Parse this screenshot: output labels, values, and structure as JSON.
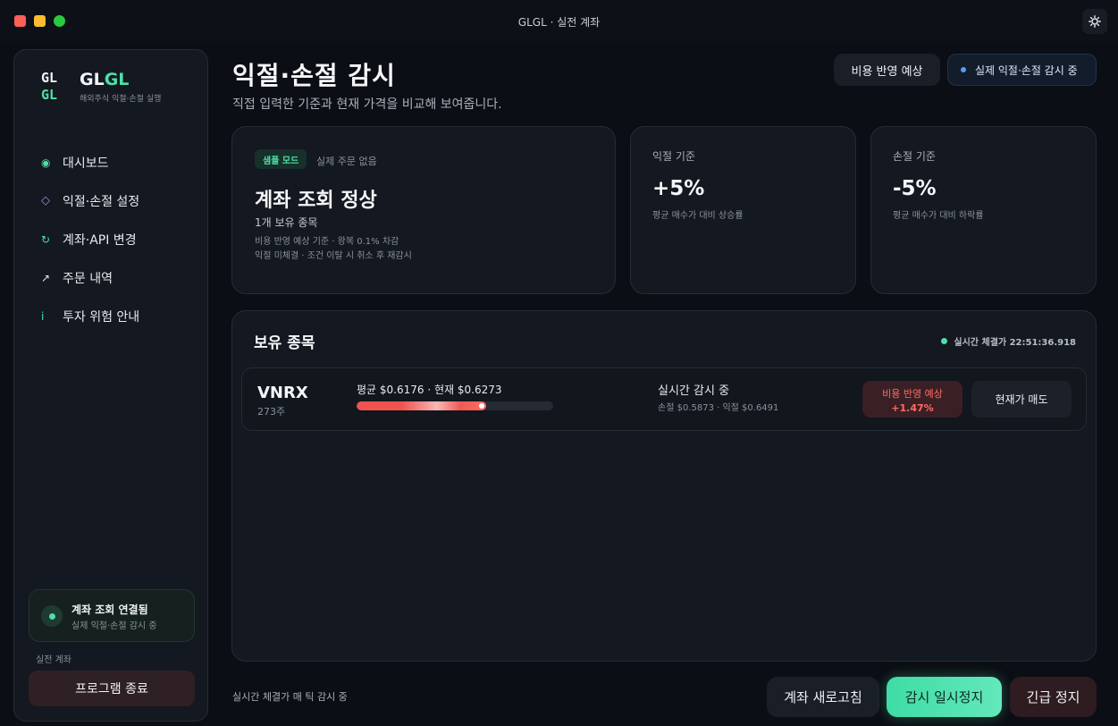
{
  "window": {
    "title": "GLGL · 실전 계좌"
  },
  "sidebar": {
    "logo": {
      "line1": "GL",
      "line2": "GL"
    },
    "brand": {
      "part1": "GL",
      "part2": "GL",
      "subtitle": "해외주식 익절·손절 실행"
    },
    "items": [
      {
        "label": "대시보드",
        "icon": "active-dot-icon",
        "glyph": "◉"
      },
      {
        "label": "익절·손절 설정",
        "icon": "diamond-icon",
        "glyph": "◇"
      },
      {
        "label": "계좌·API 변경",
        "icon": "refresh-icon",
        "glyph": "↻"
      },
      {
        "label": "주문 내역",
        "icon": "arrow-up-right-icon",
        "glyph": "↗"
      },
      {
        "label": "투자 위험 안내",
        "icon": "info-icon",
        "glyph": "i"
      }
    ],
    "connection": {
      "title": "계좌 조회 연결됨",
      "subtitle": "실제 익절·손절 감시 중"
    },
    "account_label": "실전 계좌",
    "exit_label": "프로그램 종료"
  },
  "header": {
    "title": "익절·손절 감시",
    "subtitle": "직접 입력한 기준과 현재 가격을 비교해 보여줍니다.",
    "cost_button": "비용 반영 예상",
    "live_badge": "실제 익절·손절 감시 중"
  },
  "status_card": {
    "badge": "샘플 모드",
    "badge_note": "실제 주문 없음",
    "title": "계좌 조회 정상",
    "holdings": "1개 보유 종목",
    "line1": "비용 반영 예상 기준 · 왕복 0.1% 차감",
    "line2": "익절 미체결 · 조건 이탈 시 취소 후 재감시"
  },
  "take_profit": {
    "label": "익절 기준",
    "value": "+5%",
    "desc": "평균 매수가 대비 상승률"
  },
  "stop_loss": {
    "label": "손절 기준",
    "value": "-5%",
    "desc": "평균 매수가 대비 하락률"
  },
  "holdings": {
    "title": "보유 종목",
    "status": "실시간 체결가 22:51:36.918",
    "rows": [
      {
        "ticker": "VNRX",
        "qty": "273주",
        "prices": "평균 $0.6176  ·  현재 $0.6273",
        "progress": 0.66,
        "monitor": "실시간 감시 중",
        "thresholds": "손절 $0.5873  ·  익절 $0.6491",
        "cost_label": "비용 반영 예상",
        "cost_value": "+1.47%",
        "sell_label": "현재가 매도"
      }
    ]
  },
  "footer": {
    "note": "실시간 체결가 매 틱 감시 중",
    "refresh": "계좌 새로고침",
    "pause": "감시 일시정지",
    "stop": "긴급 정지"
  },
  "colors": {
    "accent": "#4ee0a6",
    "danger": "#ff6b66",
    "live": "#5a9bff",
    "background": "#0b0e14"
  }
}
